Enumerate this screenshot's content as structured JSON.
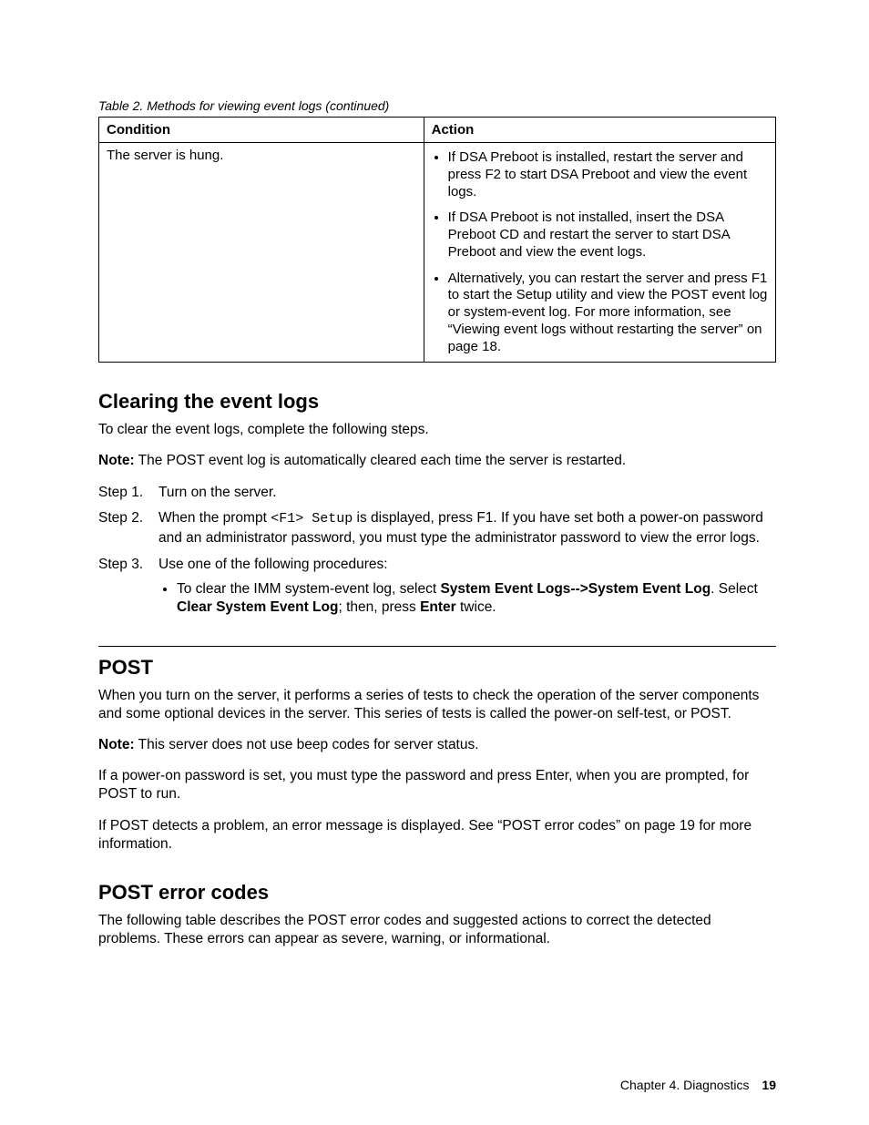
{
  "table": {
    "caption": "Table 2.  Methods for viewing event logs (continued)",
    "head": {
      "col1": "Condition",
      "col2": "Action"
    },
    "row": {
      "condition": "The server is hung.",
      "actions": [
        "If DSA Preboot is installed, restart the server and press F2 to start DSA Preboot and view the event logs.",
        "If DSA Preboot is not installed, insert the DSA Preboot CD and restart the server to start DSA Preboot and view the event logs.",
        "Alternatively, you can restart the server and press F1 to start the Setup utility and view the POST event log or system-event log. For more information, see “Viewing event logs without restarting the server” on page 18."
      ]
    }
  },
  "clearing": {
    "heading": "Clearing the event logs",
    "intro": "To clear the event logs, complete the following steps.",
    "note_label": "Note:",
    "note_body": " The POST event log is automatically cleared each time the server is restarted.",
    "step_labels": [
      "Step 1.",
      "Step 2.",
      "Step 3."
    ],
    "step1": "Turn on the server.",
    "step2_a": "When the prompt ",
    "step2_code": "<F1> Setup",
    "step2_b": " is displayed, press F1. If you have set both a power-on password and an administrator password, you must type the administrator password to view the error logs.",
    "step3": "Use one of the following procedures:",
    "step3_bullet_a": "To clear the IMM system-event log, select ",
    "step3_bullet_b1": "System Event Logs-->System Event Log",
    "step3_bullet_c": ". Select ",
    "step3_bullet_b2": "Clear System Event Log",
    "step3_bullet_d": "; then, press ",
    "step3_bullet_b3": "Enter",
    "step3_bullet_e": " twice."
  },
  "post": {
    "heading": "POST",
    "p1": "When you turn on the server, it performs a series of tests to check the operation of the server components and some optional devices in the server. This series of tests is called the power-on self-test, or POST.",
    "note_label": "Note:",
    "note_body": " This server does not use beep codes for server status.",
    "p2": "If a power-on password is set, you must type the password and press Enter, when you are prompted, for POST to run.",
    "p3": "If POST detects a problem, an error message is displayed. See “POST error codes” on page 19 for more information."
  },
  "errcodes": {
    "heading": "POST error codes",
    "p1": "The following table describes the POST error codes and suggested actions to correct the detected problems. These errors can appear as severe, warning, or informational."
  },
  "footer": {
    "chapter": "Chapter 4. Diagnostics",
    "page": "19"
  }
}
